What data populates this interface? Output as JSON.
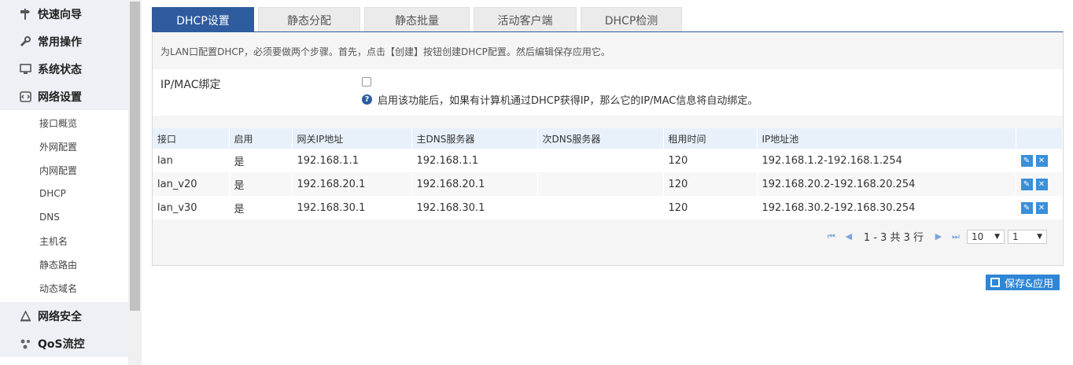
{
  "sidebar": {
    "top_items": [
      {
        "label": "快速向导",
        "icon": "signpost-icon"
      },
      {
        "label": "常用操作",
        "icon": "wrench-icon"
      },
      {
        "label": "系统状态",
        "icon": "monitor-icon"
      },
      {
        "label": "网络设置",
        "icon": "network-icon"
      }
    ],
    "sub_items": [
      "接口概览",
      "外网配置",
      "内网配置",
      "DHCP",
      "DNS",
      "主机名",
      "静态路由",
      "动态域名"
    ],
    "bottom_items": [
      {
        "label": "网络安全",
        "icon": "security-icon"
      },
      {
        "label": "QoS流控",
        "icon": "qos-icon"
      }
    ]
  },
  "tabs": [
    "DHCP设置",
    "静态分配",
    "静态批量",
    "活动客户端",
    "DHCP检测"
  ],
  "hint": "为LAN口配置DHCP，必须要做两个步骤。首先，点击【创建】按钮创建DHCP配置。然后编辑保存应用它。",
  "ip_mac_binding": {
    "label": "IP/MAC绑定",
    "help": "启用该功能后，如果有计算机通过DHCP获得IP，那么它的IP/MAC信息将自动绑定。",
    "checked": false
  },
  "table": {
    "headers": [
      "接口",
      "启用",
      "网关IP地址",
      "主DNS服务器",
      "次DNS服务器",
      "租用时间",
      "IP地址池",
      ""
    ],
    "rows": [
      [
        "lan",
        "是",
        "192.168.1.1",
        "192.168.1.1",
        "",
        "120",
        "192.168.1.2-192.168.1.254"
      ],
      [
        "lan_v20",
        "是",
        "192.168.20.1",
        "192.168.20.1",
        "",
        "120",
        "192.168.20.2-192.168.20.254"
      ],
      [
        "lan_v30",
        "是",
        "192.168.30.1",
        "192.168.30.1",
        "",
        "120",
        "192.168.30.2-192.168.30.254"
      ]
    ]
  },
  "pager": {
    "text": "1 - 3 共 3 行",
    "page_size": "10",
    "page": "1"
  },
  "save_button": "保存&应用",
  "colors": {
    "accent": "#2e5c9e",
    "button": "#2f86d6",
    "header_bg": "#e8f1fa"
  }
}
